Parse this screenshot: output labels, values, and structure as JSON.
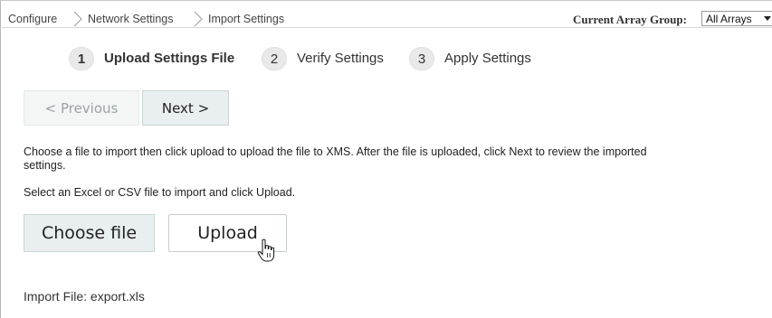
{
  "breadcrumb": {
    "items": [
      "Configure",
      "Network Settings",
      "Import Settings"
    ]
  },
  "array_group": {
    "label": "Current Array Group:",
    "selected": "All Arrays"
  },
  "steps": [
    {
      "number": "1",
      "label": "Upload Settings File",
      "active": true
    },
    {
      "number": "2",
      "label": "Verify Settings",
      "active": false
    },
    {
      "number": "3",
      "label": "Apply Settings",
      "active": false
    }
  ],
  "nav": {
    "previous_label": "< Previous",
    "next_label": "Next >"
  },
  "instructions": {
    "line1": "Choose a file to import then click upload to upload the file to XMS. After the file is uploaded, click Next to review the imported",
    "line2": "settings.",
    "line3": "Select an Excel or CSV file to import and click Upload."
  },
  "file_actions": {
    "choose_label": "Choose file",
    "upload_label": "Upload"
  },
  "import_file": {
    "text": "Import File: export.xls"
  },
  "colors": {
    "button_bg": "#e9eff0",
    "disabled_text": "#9aa3a3",
    "step_circle": "#e9e9e9"
  }
}
